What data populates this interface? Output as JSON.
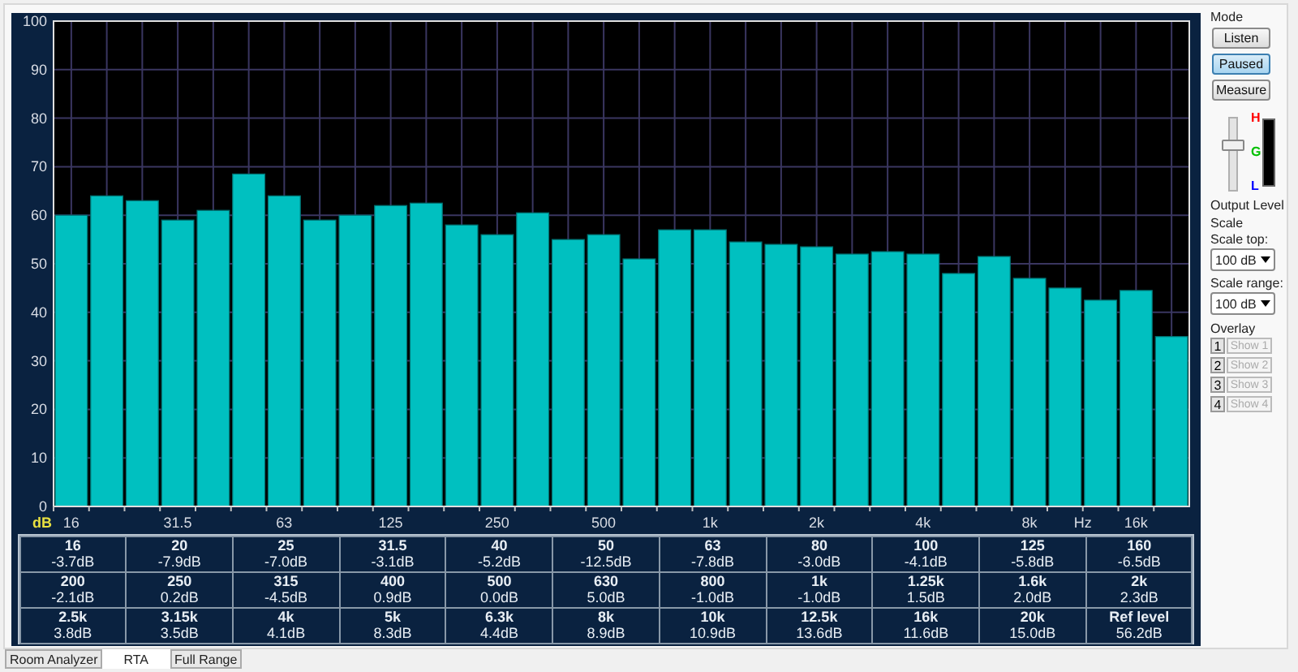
{
  "chart": {
    "chart_data": {
      "type": "bar",
      "xlabel": "Hz",
      "ylabel": "dB",
      "categories": [
        "16",
        null,
        null,
        "31.5",
        null,
        null,
        "63",
        null,
        null,
        "125",
        null,
        null,
        "250",
        null,
        null,
        "500",
        null,
        null,
        "1k",
        null,
        null,
        "2k",
        null,
        null,
        "4k",
        null,
        null,
        "8k",
        null,
        null,
        "16k",
        null
      ],
      "grid": true,
      "series": [
        {
          "color": "#00c0c0",
          "values": [
            60,
            64,
            63,
            59,
            61,
            68.5,
            64,
            59,
            60,
            62,
            62.5,
            58,
            56,
            60.5,
            55,
            56,
            51,
            57,
            57,
            54.5,
            54,
            53.5,
            52,
            52.5,
            52,
            48,
            51.5,
            47,
            45,
            42.5,
            44.5,
            35
          ]
        }
      ],
      "ylim": [
        0,
        100
      ],
      "yticks": [
        0,
        10,
        20,
        30,
        40,
        50,
        60,
        70,
        80,
        90,
        100
      ]
    }
  },
  "bands": [
    [
      {
        "freq": "16",
        "value": "-3.7dB"
      },
      {
        "freq": "20",
        "value": "-7.9dB"
      },
      {
        "freq": "25",
        "value": "-7.0dB"
      },
      {
        "freq": "31.5",
        "value": "-3.1dB"
      },
      {
        "freq": "40",
        "value": "-5.2dB"
      },
      {
        "freq": "50",
        "value": "-12.5dB"
      },
      {
        "freq": "63",
        "value": "-7.8dB"
      },
      {
        "freq": "80",
        "value": "-3.0dB"
      },
      {
        "freq": "100",
        "value": "-4.1dB"
      },
      {
        "freq": "125",
        "value": "-5.8dB"
      },
      {
        "freq": "160",
        "value": "-6.5dB"
      }
    ],
    [
      {
        "freq": "200",
        "value": "-2.1dB"
      },
      {
        "freq": "250",
        "value": "0.2dB"
      },
      {
        "freq": "315",
        "value": "-4.5dB"
      },
      {
        "freq": "400",
        "value": "0.9dB"
      },
      {
        "freq": "500",
        "value": "0.0dB"
      },
      {
        "freq": "630",
        "value": "5.0dB"
      },
      {
        "freq": "800",
        "value": "-1.0dB"
      },
      {
        "freq": "1k",
        "value": "-1.0dB"
      },
      {
        "freq": "1.25k",
        "value": "1.5dB"
      },
      {
        "freq": "1.6k",
        "value": "2.0dB"
      },
      {
        "freq": "2k",
        "value": "2.3dB"
      }
    ],
    [
      {
        "freq": "2.5k",
        "value": "3.8dB"
      },
      {
        "freq": "3.15k",
        "value": "3.5dB"
      },
      {
        "freq": "4k",
        "value": "4.1dB"
      },
      {
        "freq": "5k",
        "value": "8.3dB"
      },
      {
        "freq": "6.3k",
        "value": "4.4dB"
      },
      {
        "freq": "8k",
        "value": "8.9dB"
      },
      {
        "freq": "10k",
        "value": "10.9dB"
      },
      {
        "freq": "12.5k",
        "value": "13.6dB"
      },
      {
        "freq": "16k",
        "value": "11.6dB"
      },
      {
        "freq": "20k",
        "value": "15.0dB"
      },
      {
        "freq": "Ref level",
        "value": "56.2dB"
      }
    ]
  ],
  "mode": {
    "title": "Mode",
    "buttons": [
      {
        "label": "Listen",
        "selected": false
      },
      {
        "label": "Paused",
        "selected": true
      },
      {
        "label": "Measure",
        "selected": false
      }
    ]
  },
  "output": {
    "level": 0.67,
    "label": "Output Level",
    "meter_marks": [
      {
        "text": "H",
        "color": "#ff0000"
      },
      {
        "text": "G",
        "color": "#00c000"
      },
      {
        "text": "L",
        "color": "#0000ff"
      }
    ]
  },
  "scale": {
    "title": "Scale",
    "fields": [
      {
        "label": "Scale top:",
        "value": "100 dB"
      },
      {
        "label": "Scale range:",
        "value": "100 dB"
      }
    ]
  },
  "overlay": {
    "title": "Overlay",
    "items": [
      {
        "number": "1",
        "label": "Show 1",
        "disabled": true
      },
      {
        "number": "2",
        "label": "Show 2",
        "disabled": true
      },
      {
        "number": "3",
        "label": "Show 3",
        "disabled": true
      },
      {
        "number": "4",
        "label": "Show 4",
        "disabled": true
      }
    ]
  },
  "tabs": [
    {
      "label": "Room Analyzer",
      "selected": false
    },
    {
      "label": "RTA",
      "selected": true
    },
    {
      "label": "Full Range",
      "selected": false
    }
  ]
}
